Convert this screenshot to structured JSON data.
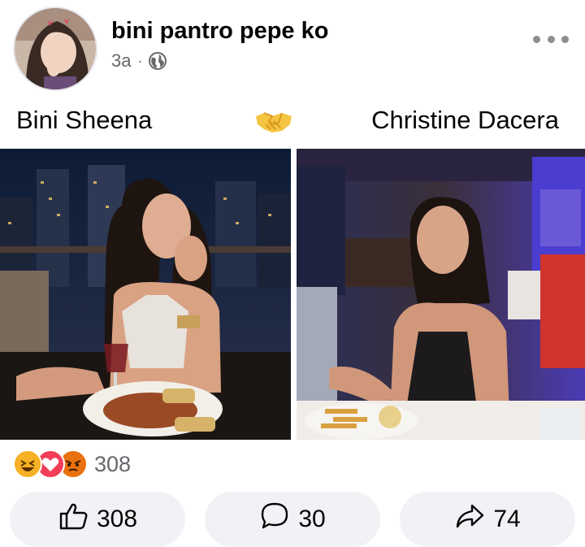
{
  "post": {
    "author": "bini pantro pepe ko",
    "time": "3a",
    "separator": "·",
    "privacy_icon": "globe-icon",
    "more_icon": "more-options-icon"
  },
  "caption": {
    "left_name": "Bini Sheena",
    "emoji": "handshake-emoji",
    "right_name": "Christine Dacera"
  },
  "photos": {
    "left": "photo-woman-with-wine-city-night",
    "right": "photo-woman-black-dress-restaurant"
  },
  "reactions": {
    "icons": [
      "haha-icon",
      "love-icon",
      "angry-icon"
    ],
    "count": "308"
  },
  "actions": {
    "like_count": "308",
    "comment_count": "30",
    "share_count": "74"
  },
  "colors": {
    "secondary_text": "#65676b",
    "button_bg": "#f0f2f5",
    "love": "#f33e58",
    "haha": "#f7b125",
    "angry": "#e9710f"
  }
}
